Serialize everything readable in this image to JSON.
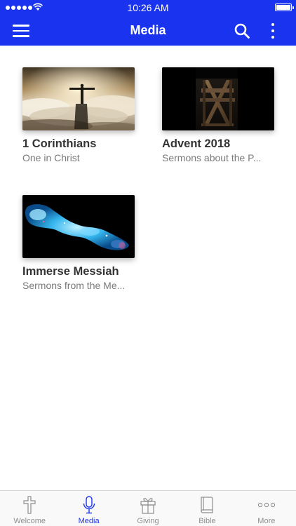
{
  "status_bar": {
    "time": "10:26 AM"
  },
  "nav": {
    "title": "Media"
  },
  "cards": [
    {
      "title": "1 Corinthians",
      "subtitle": "One in Christ"
    },
    {
      "title": "Advent 2018",
      "subtitle": "Sermons about the P..."
    },
    {
      "title": "Immerse Messiah",
      "subtitle": "Sermons from the Me..."
    }
  ],
  "tabs": [
    {
      "label": "Welcome",
      "icon": "cross-icon",
      "active": false
    },
    {
      "label": "Media",
      "icon": "microphone-icon",
      "active": true
    },
    {
      "label": "Giving",
      "icon": "gift-icon",
      "active": false
    },
    {
      "label": "Bible",
      "icon": "book-icon",
      "active": false
    },
    {
      "label": "More",
      "icon": "ellipsis-icon",
      "active": false
    }
  ],
  "colors": {
    "brand": "#1a33ee",
    "active_tab": "#1a33ee",
    "inactive_tab": "#8e8e8e"
  }
}
